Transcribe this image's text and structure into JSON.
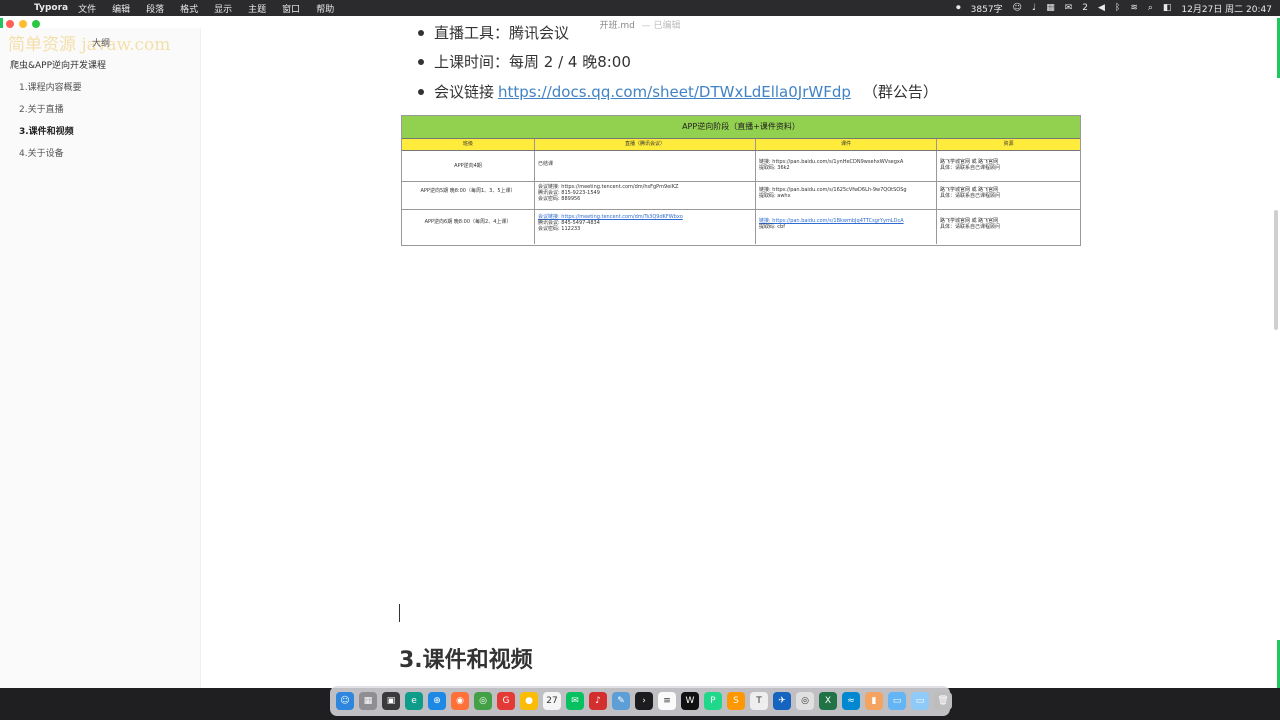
{
  "menubar": {
    "apple_icon": "apple-icon",
    "app_name": "Typora",
    "items": [
      "文件",
      "编辑",
      "段落",
      "格式",
      "显示",
      "主题",
      "窗口",
      "帮助"
    ],
    "word_count": "3857字",
    "wechat_badge": "2",
    "datetime": "12月27日 周二 20:47"
  },
  "window": {
    "title": "开班.md",
    "saved": "— 已编辑"
  },
  "sidebar": {
    "watermark": "简单资源 javaw.com",
    "tab_label": "大纲",
    "outline": [
      {
        "label": "爬虫&APP逆向开发课程",
        "level": 1
      },
      {
        "label": "1.课程内容概要",
        "level": 2
      },
      {
        "label": "2.关于直播",
        "level": 2
      },
      {
        "label": "3.课件和视频",
        "level": 2,
        "active": true
      },
      {
        "label": "4.关于设备",
        "level": 2
      }
    ]
  },
  "content": {
    "bullets": [
      {
        "text": "直播工具：腾讯会议"
      },
      {
        "text": "上课时间：每周 2 / 4  晚8:00"
      },
      {
        "text": "会议链接",
        "link": "https://docs.qq.com/sheet/DTWxLdElla0JrWFdp",
        "tail": "（群公告）"
      }
    ],
    "table": {
      "title": "APP逆向阶段（直播+课件资料）",
      "headers": [
        "班级",
        "直播（腾讯会议）",
        "课件",
        "资源"
      ],
      "rows": [
        {
          "c1": "APP逆向4期",
          "c2": [
            "已结课"
          ],
          "c3": [
            "链接: https://pan.baidu.com/s/1ynHeCDN9wsehxWVsegxA",
            "提取码: 36k2"
          ],
          "c4": [
            "路飞学城官网 或 路飞官网",
            "具体：请联系自己课程顾问"
          ]
        },
        {
          "c1": "APP逆向5期  晚8:00（每周1、3、5上课）",
          "c2": [
            "会议链接: https://meeting.tencent.com/dm/hsFgPm9eiKZ",
            "腾讯会议: 815-9223-1549",
            "会议密码: 889956"
          ],
          "c3": [
            "链接: https://pan.baidu.com/s/1625cVfwD6Lh-9w7QOtSOSg",
            "提取码: awhx"
          ],
          "c4": [
            "路飞学城官网 或 路飞官网",
            "具体：请联系自己课程顾问"
          ]
        },
        {
          "c1": "APP逆向6期  晚8:00（每周2、4上课）",
          "c2": [
            "会议链接: https://meeting.tencent.com/dm/Ts3Q9dKFWbxo",
            "腾讯会议: 845-5497-4834",
            "会议密码: 112233"
          ],
          "c3": [
            "链接: https://pan.baidu.com/s/1BkwmbJq4TTCsgrYymLDcA",
            "提取码: cbf"
          ],
          "c4": [
            "路飞学城官网 或 路飞官网",
            "具体：请联系自己课程顾问"
          ]
        }
      ]
    },
    "heading": "3.课件和视频"
  },
  "dock": {
    "apps": [
      {
        "name": "finder-icon",
        "color": "#2e86de",
        "glyph": "☺"
      },
      {
        "name": "launchpad-icon",
        "color": "#8e8e93",
        "glyph": "▦"
      },
      {
        "name": "mission-control-icon",
        "color": "#3a3a3c",
        "glyph": "▣"
      },
      {
        "name": "edge-icon",
        "color": "#0f9d8a",
        "glyph": "e"
      },
      {
        "name": "safari-icon",
        "color": "#1e88e5",
        "glyph": "⊕"
      },
      {
        "name": "firefox-icon",
        "color": "#ff7139",
        "glyph": "◉"
      },
      {
        "name": "chrome-green-icon",
        "color": "#43a047",
        "glyph": "◎"
      },
      {
        "name": "app-red-icon",
        "color": "#e53935",
        "glyph": "G"
      },
      {
        "name": "chrome-icon",
        "color": "#fbbc05",
        "glyph": "●"
      },
      {
        "name": "calendar-icon",
        "color": "#f5f5f5",
        "glyph": "27"
      },
      {
        "name": "wechat-icon",
        "color": "#07c160",
        "glyph": "✉"
      },
      {
        "name": "netease-music-icon",
        "color": "#d32f2f",
        "glyph": "♪"
      },
      {
        "name": "preview-icon",
        "color": "#5e9ed6",
        "glyph": "✎"
      },
      {
        "name": "terminal-icon",
        "color": "#1c1c1e",
        "glyph": "›"
      },
      {
        "name": "text-file-icon",
        "color": "#fafafa",
        "glyph": "≡"
      },
      {
        "name": "webstorm-icon",
        "color": "#111111",
        "glyph": "W"
      },
      {
        "name": "pycharm-icon",
        "color": "#21d789",
        "glyph": "P"
      },
      {
        "name": "sublime-icon",
        "color": "#ff9800",
        "glyph": "S"
      },
      {
        "name": "typora-icon",
        "color": "#eeeeee",
        "glyph": "T"
      },
      {
        "name": "app-blue-icon",
        "color": "#1565c0",
        "glyph": "✈"
      },
      {
        "name": "chrome-alt-icon",
        "color": "#e0e0e0",
        "glyph": "◎"
      },
      {
        "name": "excel-icon",
        "color": "#217346",
        "glyph": "X"
      },
      {
        "name": "app-wave-icon",
        "color": "#0288d1",
        "glyph": "≈"
      },
      {
        "name": "archive-icon",
        "color": "#f4a460",
        "glyph": "▮"
      },
      {
        "name": "folder-icon",
        "color": "#64b5f6",
        "glyph": "▭"
      },
      {
        "name": "folder-downloads-icon",
        "color": "#90caf9",
        "glyph": "▭"
      },
      {
        "name": "trash-icon",
        "color": "#bdbdbd",
        "glyph": "🗑"
      }
    ]
  }
}
